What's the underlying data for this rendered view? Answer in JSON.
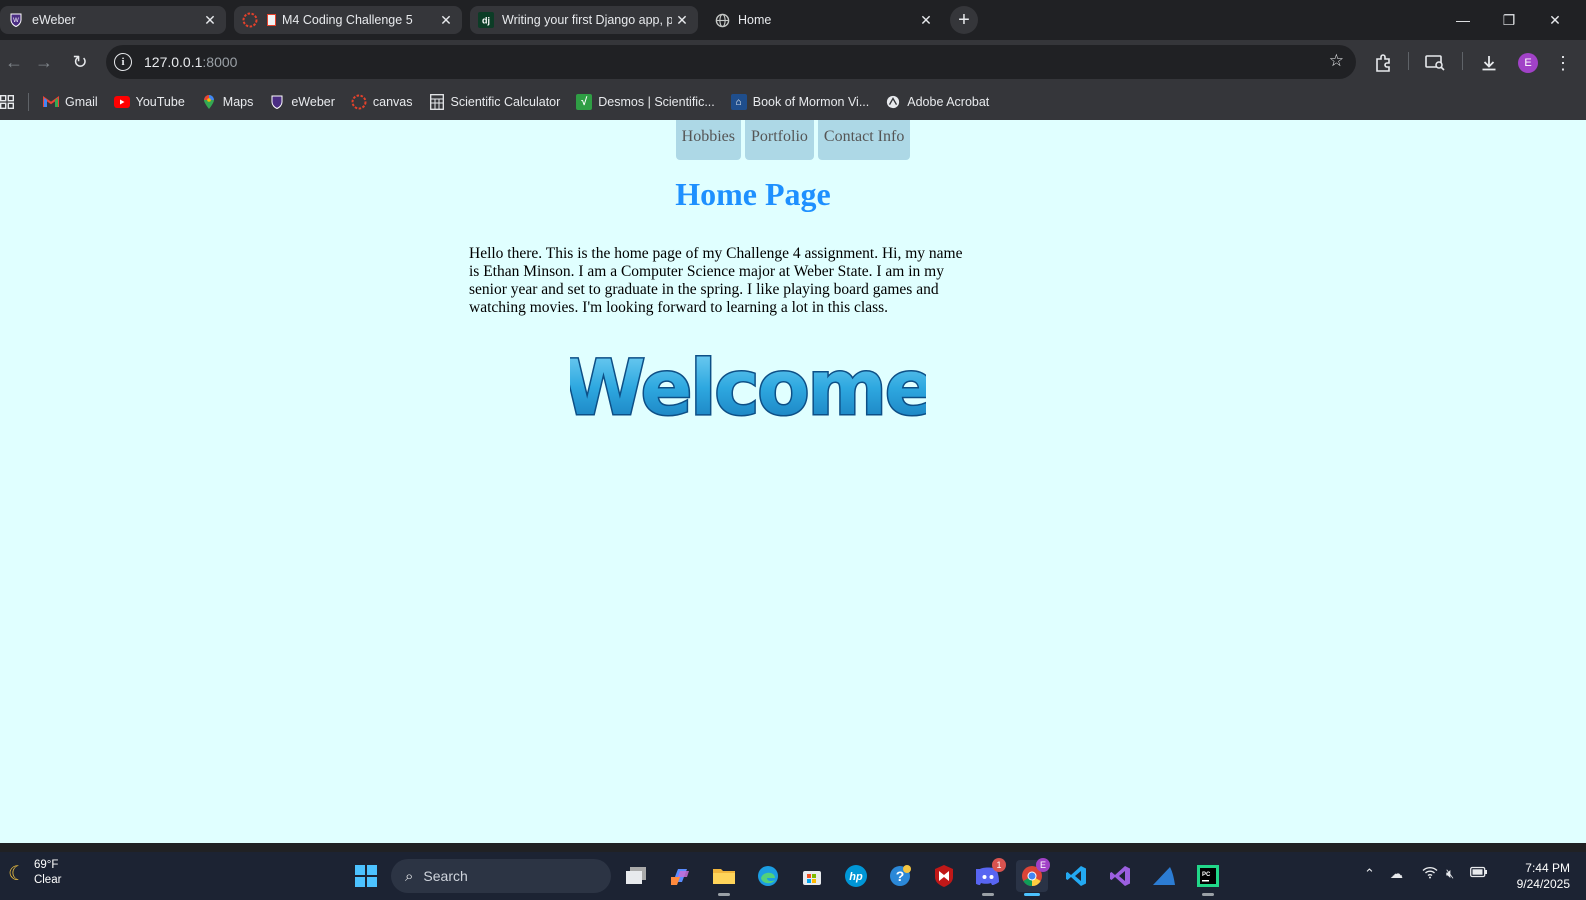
{
  "browser": {
    "tabs": [
      {
        "title": "eWeber",
        "icon": "eweber-shield-icon"
      },
      {
        "title": "M4 Coding Challenge 5",
        "icon": "canvas-icon"
      },
      {
        "title": "Writing your first Django app, p",
        "icon": "django-icon"
      },
      {
        "title": "Home",
        "icon": "globe-icon",
        "active": true
      }
    ],
    "new_tab": "+",
    "url_host": "127.0.0.1",
    "url_port": ":8000",
    "profile_initial": "E",
    "bookmarks": [
      {
        "label": "Gmail",
        "icon": "gmail-icon"
      },
      {
        "label": "YouTube",
        "icon": "youtube-icon"
      },
      {
        "label": "Maps",
        "icon": "maps-icon"
      },
      {
        "label": "eWeber",
        "icon": "eweber-shield-icon"
      },
      {
        "label": "canvas",
        "icon": "canvas-icon"
      },
      {
        "label": "Scientific Calculator",
        "icon": "calculator-icon"
      },
      {
        "label": "Desmos | Scientific...",
        "icon": "desmos-icon"
      },
      {
        "label": "Book of Mormon Vi...",
        "icon": "book-icon"
      },
      {
        "label": "Adobe Acrobat",
        "icon": "acrobat-icon"
      }
    ]
  },
  "page": {
    "nav": [
      "Hobbies",
      "Portfolio",
      "Contact Info"
    ],
    "title": "Home Page",
    "intro": "Hello there. This is the home page of my Challenge 4 assignment. Hi, my name is Ethan Minson. I am a Computer Science major at Weber State. I am in my senior year and set to graduate in the spring. I like playing board games and watching movies. I'm looking forward to learning a lot in this class.",
    "welcome_image_text": "Welcome"
  },
  "taskbar": {
    "weather_temp": "69°F",
    "weather_desc": "Clear",
    "search_label": "Search",
    "discord_badge": "1",
    "chrome_badge": "E",
    "time": "7:44 PM",
    "date": "9/24/2025"
  },
  "colors": {
    "page_bg": "#e0ffff",
    "nav_bg": "#add8e6",
    "title": "#1e90ff"
  }
}
